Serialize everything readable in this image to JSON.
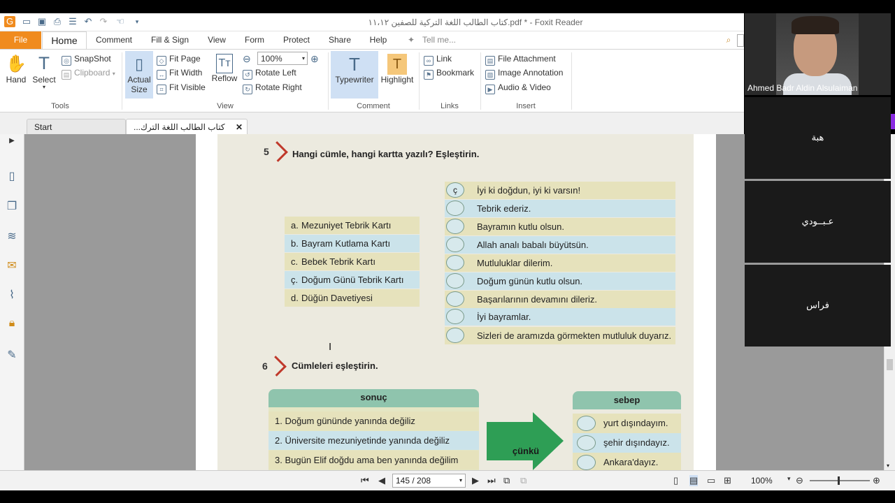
{
  "window": {
    "title": "كتاب الطالب اللغة التركية للصفين ١١،١٢.pdf * - Foxit Reader"
  },
  "menu": {
    "file": "File",
    "home": "Home",
    "comment": "Comment",
    "fill_sign": "Fill & Sign",
    "view": "View",
    "form": "Form",
    "protect": "Protect",
    "share": "Share",
    "help": "Help",
    "tell_me": "Tell me..."
  },
  "ribbon": {
    "hand": "Hand",
    "select": "Select",
    "snapshot": "SnapShot",
    "clipboard": "Clipboard",
    "tools_group": "Tools",
    "actual_size_1": "Actual",
    "actual_size_2": "Size",
    "fit_page": "Fit Page",
    "fit_width": "Fit Width",
    "fit_visible": "Fit Visible",
    "reflow": "Reflow",
    "zoom_value": "100%",
    "rotate_left": "Rotate Left",
    "rotate_right": "Rotate Right",
    "view_group": "View",
    "typewriter": "Typewriter",
    "highlight": "Highlight",
    "comment_group": "Comment",
    "link": "Link",
    "bookmark": "Bookmark",
    "links_group": "Links",
    "file_attachment": "File Attachment",
    "image_annotation": "Image Annotation",
    "audio_video": "Audio & Video",
    "insert_group": "Insert"
  },
  "tabs": {
    "start": "Start",
    "doc": "...كتاب الطالب اللغة الترك"
  },
  "exercise5": {
    "number": "5",
    "title": "Hangi cümle, hangi kartta yazılı? Eşleştirin.",
    "cards": [
      {
        "letter": "a.",
        "text": "Mezuniyet Tebrik Kartı"
      },
      {
        "letter": "b.",
        "text": "Bayram Kutlama Kartı"
      },
      {
        "letter": "c.",
        "text": "Bebek Tebrik Kartı"
      },
      {
        "letter": "ç.",
        "text": "Doğum Günü Tebrik Kartı"
      },
      {
        "letter": "d.",
        "text": "Düğün Davetiyesi"
      }
    ],
    "sentences": [
      {
        "answer": "ç",
        "text": "İyi ki doğdun, iyi ki varsın!"
      },
      {
        "answer": "",
        "text": "Tebrik ederiz."
      },
      {
        "answer": "",
        "text": "Bayramın kutlu olsun."
      },
      {
        "answer": "",
        "text": "Allah analı babalı büyütsün."
      },
      {
        "answer": "",
        "text": "Mutluluklar dilerim."
      },
      {
        "answer": "",
        "text": "Doğum günün kutlu olsun."
      },
      {
        "answer": "",
        "text": "Başarılarının devamını dileriz."
      },
      {
        "answer": "",
        "text": "İyi bayramlar."
      },
      {
        "answer": "",
        "text": "Sizleri de aramızda görmekten mutluluk duyarız."
      }
    ]
  },
  "exercise6": {
    "number": "6",
    "title": "Cümleleri eşleştirin.",
    "sonuc_header": "sonuç",
    "sonuc": [
      "1. Doğum gününde yanında değiliz",
      "2. Üniversite mezuniyetinde yanında değiliz",
      "3. Bugün Elif doğdu ama ben yanında değilim"
    ],
    "connector": "çünkü",
    "sebep_header": "sebep",
    "sebep": [
      "yurt dışındayım.",
      "şehir dışındayız.",
      "Ankara'dayız."
    ]
  },
  "status": {
    "page": "145 / 208",
    "zoom": "100%"
  },
  "participants": [
    {
      "name": "Ahmed Badr Aldin Alsulaiman"
    },
    {
      "name": "هبة"
    },
    {
      "name": "عـبــودي"
    },
    {
      "name": "فراس"
    }
  ],
  "colors": {
    "file_tab": "#f08b1e",
    "header_green": "#8fc4ad",
    "arrow_green": "#2e9e55",
    "row_yellow": "#e6e2bc",
    "row_blue": "#cbe3ea",
    "section_red": "#c0392b"
  }
}
